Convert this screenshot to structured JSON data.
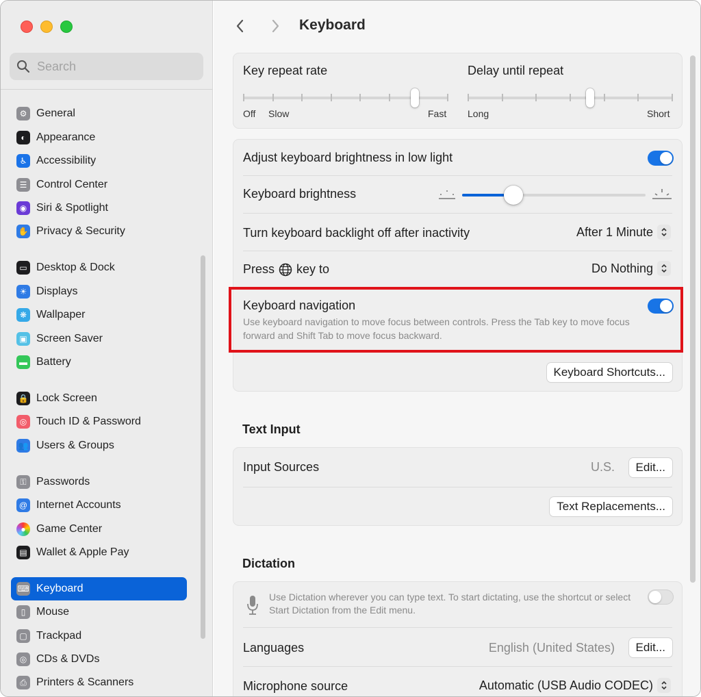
{
  "search": {
    "placeholder": "Search"
  },
  "sidebar": {
    "items": [
      {
        "label": "General",
        "icon": "gear-icon",
        "color": "#8e8e93"
      },
      {
        "label": "Appearance",
        "icon": "appearance-icon",
        "color": "#1d1d1f"
      },
      {
        "label": "Accessibility",
        "icon": "accessibility-icon",
        "color": "#1a73e8"
      },
      {
        "label": "Control Center",
        "icon": "control-center-icon",
        "color": "#8e8e93"
      },
      {
        "label": "Siri & Spotlight",
        "icon": "siri-icon",
        "color": "#6b3bd6"
      },
      {
        "label": "Privacy & Security",
        "icon": "hand-icon",
        "color": "#2f7be5"
      },
      {
        "label": "Desktop & Dock",
        "icon": "dock-icon",
        "color": "#1d1d1f"
      },
      {
        "label": "Displays",
        "icon": "sun-icon",
        "color": "#2f7be5"
      },
      {
        "label": "Wallpaper",
        "icon": "wallpaper-icon",
        "color": "#35a9e8"
      },
      {
        "label": "Screen Saver",
        "icon": "screen-saver-icon",
        "color": "#54c1e6"
      },
      {
        "label": "Battery",
        "icon": "battery-icon",
        "color": "#34c759"
      },
      {
        "label": "Lock Screen",
        "icon": "lock-icon",
        "color": "#1d1d1f"
      },
      {
        "label": "Touch ID & Password",
        "icon": "fingerprint-icon",
        "color": "#f25d6b"
      },
      {
        "label": "Users & Groups",
        "icon": "users-icon",
        "color": "#2f7be5"
      },
      {
        "label": "Passwords",
        "icon": "key-icon",
        "color": "#8e8e93"
      },
      {
        "label": "Internet Accounts",
        "icon": "at-icon",
        "color": "#2f7be5"
      },
      {
        "label": "Game Center",
        "icon": "game-center-icon",
        "color": "#ffffff"
      },
      {
        "label": "Wallet & Apple Pay",
        "icon": "wallet-icon",
        "color": "#1d1d1f"
      },
      {
        "label": "Keyboard",
        "icon": "keyboard-icon",
        "color": "#8e8e93"
      },
      {
        "label": "Mouse",
        "icon": "mouse-icon",
        "color": "#8e8e93"
      },
      {
        "label": "Trackpad",
        "icon": "trackpad-icon",
        "color": "#8e8e93"
      },
      {
        "label": "CDs & DVDs",
        "icon": "disc-icon",
        "color": "#8e8e93"
      },
      {
        "label": "Printers & Scanners",
        "icon": "printer-icon",
        "color": "#8e8e93"
      }
    ],
    "active": "Keyboard"
  },
  "toolbar": {
    "title": "Keyboard"
  },
  "repeat": {
    "key_repeat_label": "Key repeat rate",
    "key_repeat_off": "Off",
    "key_repeat_slow": "Slow",
    "key_repeat_fast": "Fast",
    "key_repeat_value": 0.85,
    "delay_label": "Delay until repeat",
    "delay_long": "Long",
    "delay_short": "Short",
    "delay_value": 0.6
  },
  "brightness": {
    "adjust_label": "Adjust keyboard brightness in low light",
    "adjust_on": true,
    "brightness_label": "Keyboard brightness",
    "brightness_value": 0.28,
    "backlight_label": "Turn keyboard backlight off after inactivity",
    "backlight_value": "After 1 Minute",
    "press_label_a": "Press",
    "press_label_b": "key to",
    "press_value": "Do Nothing",
    "nav_label": "Keyboard navigation",
    "nav_desc": "Use keyboard navigation to move focus between controls. Press the Tab key to move focus forward and Shift Tab to move focus backward.",
    "nav_on": true,
    "shortcuts_button": "Keyboard Shortcuts..."
  },
  "text_input": {
    "heading": "Text Input",
    "input_sources_label": "Input Sources",
    "input_sources_value": "U.S.",
    "edit_button": "Edit...",
    "replacements_button": "Text Replacements..."
  },
  "dictation": {
    "heading": "Dictation",
    "desc": "Use Dictation wherever you can type text. To start dictating, use the shortcut or select Start Dictation from the Edit menu.",
    "on": false,
    "languages_label": "Languages",
    "languages_value": "English (United States)",
    "edit_button": "Edit...",
    "mic_label": "Microphone source",
    "mic_value": "Automatic (USB Audio CODEC)"
  },
  "colors": {
    "accent": "#0a63d8",
    "highlight": "#e0131a"
  }
}
